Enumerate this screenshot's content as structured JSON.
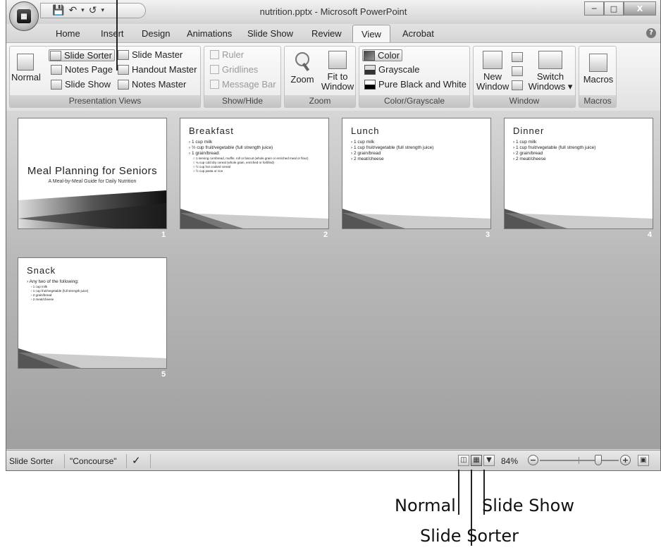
{
  "window": {
    "title": "nutrition.pptx - Microsoft PowerPoint",
    "minimize_icon": "minimize-icon",
    "maximize_icon": "maximize-icon",
    "close_icon": "close-icon"
  },
  "quick_access": {
    "save_icon": "save-icon",
    "undo_icon": "undo-icon",
    "redo_icon": "redo-icon",
    "dropdown_glyph": "▾"
  },
  "tabs": [
    "Home",
    "Insert",
    "Design",
    "Animations",
    "Slide Show",
    "Review",
    "View",
    "Acrobat"
  ],
  "active_tab": "View",
  "ribbon": {
    "presentation_views": {
      "label": "Presentation Views",
      "normal": "Normal",
      "slide_sorter": "Slide Sorter",
      "notes_page": "Notes Page",
      "slide_show": "Slide Show",
      "slide_master": "Slide Master",
      "handout_master": "Handout Master",
      "notes_master": "Notes Master"
    },
    "show_hide": {
      "label": "Show/Hide",
      "ruler": "Ruler",
      "gridlines": "Gridlines",
      "message_bar": "Message Bar"
    },
    "zoom": {
      "label": "Zoom",
      "zoom": "Zoom",
      "fit_line1": "Fit to",
      "fit_line2": "Window"
    },
    "color_grayscale": {
      "label": "Color/Grayscale",
      "color": "Color",
      "grayscale": "Grayscale",
      "pure_bw": "Pure Black and White"
    },
    "window": {
      "label": "Window",
      "new_line1": "New",
      "new_line2": "Window",
      "switch_line1": "Switch",
      "switch_line2": "Windows ▾"
    },
    "macros": {
      "label": "Macros",
      "macros": "Macros"
    }
  },
  "slides": [
    {
      "number": "1",
      "title": "Meal Planning for Seniors",
      "subtitle": "A Meal-by-Meal Guide for Daily Nutrition"
    },
    {
      "number": "2",
      "title": "Breakfast",
      "bullets": [
        "› 1 cup milk",
        "› ½ cup fruit/vegetable (full strength juice)",
        "› 1 grain/bread:"
      ],
      "subbullets": [
        "○ 1 serving cornbread, muffin, roll or biscuit (whole grain or enriched meal or flour)",
        "○ ¾ cup cold dry cereal (whole grain, enriched or fortified)",
        "○ ½ cup hot cooked cereal",
        "○ ½ cup pasta or rice"
      ]
    },
    {
      "number": "3",
      "title": "Lunch",
      "bullets": [
        "› 1 cup milk",
        "› 1 cup fruit/vegetable (full strength juice)",
        "› 2 grain/bread",
        "› 2 meat/cheese"
      ]
    },
    {
      "number": "4",
      "title": "Dinner",
      "bullets": [
        "› 1 cup milk",
        "› 1 cup fruit/vegetable (full strength juice)",
        "› 2 grain/bread",
        "› 2 meat/cheese"
      ]
    },
    {
      "number": "5",
      "title": "Snack",
      "bullets": [
        "› Any two of the following:"
      ],
      "subbullets": [
        "› 1 cup milk",
        "› 1 cup fruit/vegetable (full strength juice)",
        "› 2 grain/bread",
        "› 2 meat/cheese"
      ]
    }
  ],
  "statusbar": {
    "view_name": "Slide Sorter",
    "theme": "\"Concourse\"",
    "spellcheck_icon": "spellcheck-icon",
    "zoom_level": "84%",
    "zoom_minus": "−",
    "zoom_plus": "+",
    "fit_icon": "fit-slide-icon"
  },
  "callouts": {
    "normal": "Normal",
    "slide_sorter": "Slide Sorter",
    "slide_show": "Slide Show"
  }
}
